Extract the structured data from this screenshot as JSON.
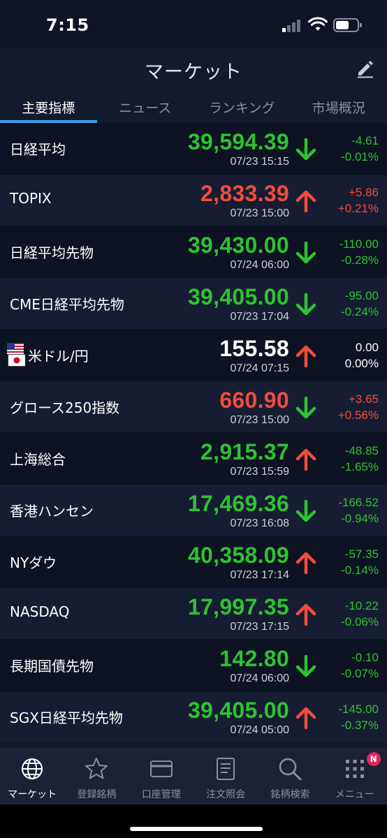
{
  "status_bar": {
    "time": "7:15"
  },
  "header": {
    "title": "マーケット"
  },
  "tabs": [
    {
      "label": "主要指標",
      "active": true
    },
    {
      "label": "ニュース",
      "active": false
    },
    {
      "label": "ランキング",
      "active": false
    },
    {
      "label": "市場概況",
      "active": false
    }
  ],
  "colors": {
    "up": "#f24c3d",
    "down": "#2fc132",
    "neutral": "#ffffff",
    "accent": "#3aa0e6"
  },
  "market": [
    {
      "name": "日経平均",
      "price": "39,594.39",
      "price_color": "green",
      "time": "07/23 15:15",
      "arrow": "down",
      "change": "-4.61",
      "change_pct": "-0.01%",
      "change_color": "green"
    },
    {
      "name": "TOPIX",
      "price": "2,833.39",
      "price_color": "red",
      "time": "07/23 15:00",
      "arrow": "up",
      "change": "+5.86",
      "change_pct": "+0.21%",
      "change_color": "red"
    },
    {
      "name": "日経平均先物",
      "price": "39,430.00",
      "price_color": "green",
      "time": "07/24 06:00",
      "arrow": "down",
      "change": "-110.00",
      "change_pct": "-0.28%",
      "change_color": "green"
    },
    {
      "name": "CME日経平均先物",
      "price": "39,405.00",
      "price_color": "green",
      "time": "07/23 17:04",
      "arrow": "down",
      "change": "-95.00",
      "change_pct": "-0.24%",
      "change_color": "green"
    },
    {
      "name": "米ドル/円",
      "flag": "us-jp-flags",
      "price": "155.58",
      "price_color": "white",
      "time": "07/24 07:15",
      "arrow": "up",
      "change": "0.00",
      "change_pct": "0.00%",
      "change_color": "white"
    },
    {
      "name": "グロース250指数",
      "price": "660.90",
      "price_color": "red",
      "time": "07/23 15:00",
      "arrow": "down",
      "change": "+3.65",
      "change_pct": "+0.56%",
      "change_color": "red"
    },
    {
      "name": "上海総合",
      "price": "2,915.37",
      "price_color": "green",
      "time": "07/23 15:59",
      "arrow": "up",
      "change": "-48.85",
      "change_pct": "-1.65%",
      "change_color": "green"
    },
    {
      "name": "香港ハンセン",
      "price": "17,469.36",
      "price_color": "green",
      "time": "07/23 16:08",
      "arrow": "down",
      "change": "-166.52",
      "change_pct": "-0.94%",
      "change_color": "green"
    },
    {
      "name": "NYダウ",
      "price": "40,358.09",
      "price_color": "green",
      "time": "07/23 17:14",
      "arrow": "up",
      "change": "-57.35",
      "change_pct": "-0.14%",
      "change_color": "green"
    },
    {
      "name": "NASDAQ",
      "price": "17,997.35",
      "price_color": "green",
      "time": "07/23 17:15",
      "arrow": "up",
      "change": "-10.22",
      "change_pct": "-0.06%",
      "change_color": "green"
    },
    {
      "name": "長期国債先物",
      "price": "142.80",
      "price_color": "green",
      "time": "07/24 06:00",
      "arrow": "down",
      "change": "-0.10",
      "change_pct": "-0.07%",
      "change_color": "green"
    },
    {
      "name": "SGX日経平均先物",
      "price": "39,405.00",
      "price_color": "green",
      "time": "07/24 05:00",
      "arrow": "up",
      "change": "-145.00",
      "change_pct": "-0.37%",
      "change_color": "green"
    }
  ],
  "bottom_nav": [
    {
      "label": "マーケット",
      "icon": "globe-icon",
      "active": true
    },
    {
      "label": "登録銘柄",
      "icon": "star-icon",
      "active": false
    },
    {
      "label": "口座管理",
      "icon": "card-icon",
      "active": false
    },
    {
      "label": "注文照会",
      "icon": "document-icon",
      "active": false
    },
    {
      "label": "銘柄検索",
      "icon": "search-icon",
      "active": false
    },
    {
      "label": "メニュー",
      "icon": "grid-menu-icon",
      "active": false,
      "badge": "N"
    }
  ]
}
